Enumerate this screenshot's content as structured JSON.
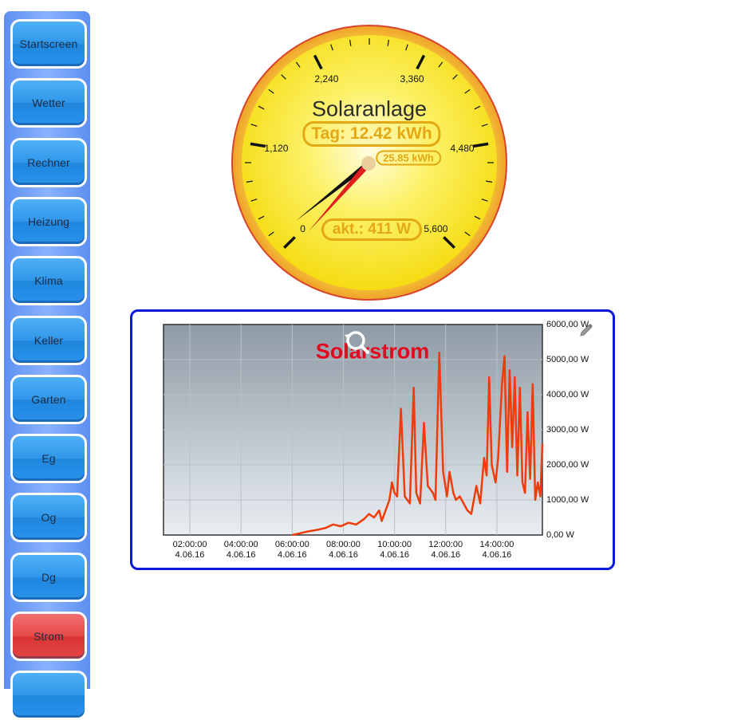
{
  "sidebar": {
    "items": [
      {
        "label": "Startscreen",
        "active": false
      },
      {
        "label": "Wetter",
        "active": false
      },
      {
        "label": "Rechner",
        "active": false
      },
      {
        "label": "Heizung",
        "active": false
      },
      {
        "label": "Klima",
        "active": false
      },
      {
        "label": "Keller",
        "active": false
      },
      {
        "label": "Garten",
        "active": false
      },
      {
        "label": "Eg",
        "active": false
      },
      {
        "label": "Og",
        "active": false
      },
      {
        "label": "Dg",
        "active": false
      },
      {
        "label": "Strom",
        "active": true
      }
    ]
  },
  "gauge": {
    "title": "Solaranlage",
    "day_label": "Tag: 12.42 kWh",
    "total_label": "25.85 kWh",
    "current_label": "akt.: 411 W",
    "scale_labels": [
      "0",
      "1,120",
      "2,240",
      "3,360",
      "4,480",
      "5,600"
    ],
    "scale_max": 5600,
    "current_value": 411,
    "colors": {
      "face": "#f9e52a",
      "rim": "#f4ac2a",
      "accent": "#e3a813"
    }
  },
  "chart": {
    "title": "Solarstrom",
    "icons": [
      "reset-zoom-icon",
      "edit-icon"
    ],
    "y_tick_labels": [
      "6000,00 W",
      "5000,00 W",
      "4000,00 W",
      "3000,00 W",
      "2000,00 W",
      "1000,00 W",
      "0,00 W"
    ],
    "x_tick_labels": [
      {
        "time": "02:00:00",
        "date": "4.06.16"
      },
      {
        "time": "04:00:00",
        "date": "4.06.16"
      },
      {
        "time": "06:00:00",
        "date": "4.06.16"
      },
      {
        "time": "08:00:00",
        "date": "4.06.16"
      },
      {
        "time": "10:00:00",
        "date": "4.06.16"
      },
      {
        "time": "12:00:00",
        "date": "4.06.16"
      },
      {
        "time": "14:00:00",
        "date": "4.06.16"
      }
    ],
    "line_color": "#ef3c0a"
  },
  "chart_data": {
    "type": "line",
    "title": "Solarstrom",
    "xlabel": "",
    "ylabel": "",
    "x_unit": "hour of day (4.06.16)",
    "ylim": [
      0,
      6000
    ],
    "xlim": [
      0.97,
      15.78
    ],
    "grid": true,
    "series": [
      {
        "x": [
          6.0,
          6.3,
          6.6,
          7.0,
          7.3,
          7.6,
          7.9,
          8.2,
          8.5,
          8.8,
          9.0,
          9.2,
          9.4,
          9.5,
          9.65,
          9.8,
          9.9,
          10.0,
          10.1,
          10.25,
          10.4,
          10.6,
          10.75,
          10.85,
          11.0,
          11.15,
          11.3,
          11.5,
          11.6,
          11.75,
          11.9,
          12.05,
          12.15,
          12.3,
          12.4,
          12.55,
          12.7,
          12.85,
          13.0,
          13.2,
          13.35,
          13.5,
          13.6,
          13.7,
          13.8,
          13.95,
          14.05,
          14.2,
          14.3,
          14.4,
          14.5,
          14.6,
          14.7,
          14.8,
          14.9,
          15.0,
          15.1,
          15.2,
          15.3,
          15.4,
          15.5,
          15.6,
          15.7,
          15.78
        ],
        "y": [
          0,
          50,
          100,
          150,
          200,
          300,
          250,
          350,
          300,
          450,
          600,
          500,
          700,
          400,
          700,
          1000,
          1500,
          1200,
          1100,
          3600,
          1100,
          900,
          4200,
          1200,
          900,
          3200,
          1400,
          1200,
          1000,
          5200,
          1800,
          1100,
          1800,
          1200,
          1000,
          1100,
          900,
          700,
          600,
          1400,
          900,
          2200,
          1700,
          4500,
          2000,
          1500,
          2200,
          4300,
          5100,
          1800,
          4700,
          2500,
          4500,
          1700,
          4200,
          1500,
          1200,
          3500,
          1600,
          4300,
          1000,
          1500,
          1100,
          2600
        ]
      }
    ]
  }
}
